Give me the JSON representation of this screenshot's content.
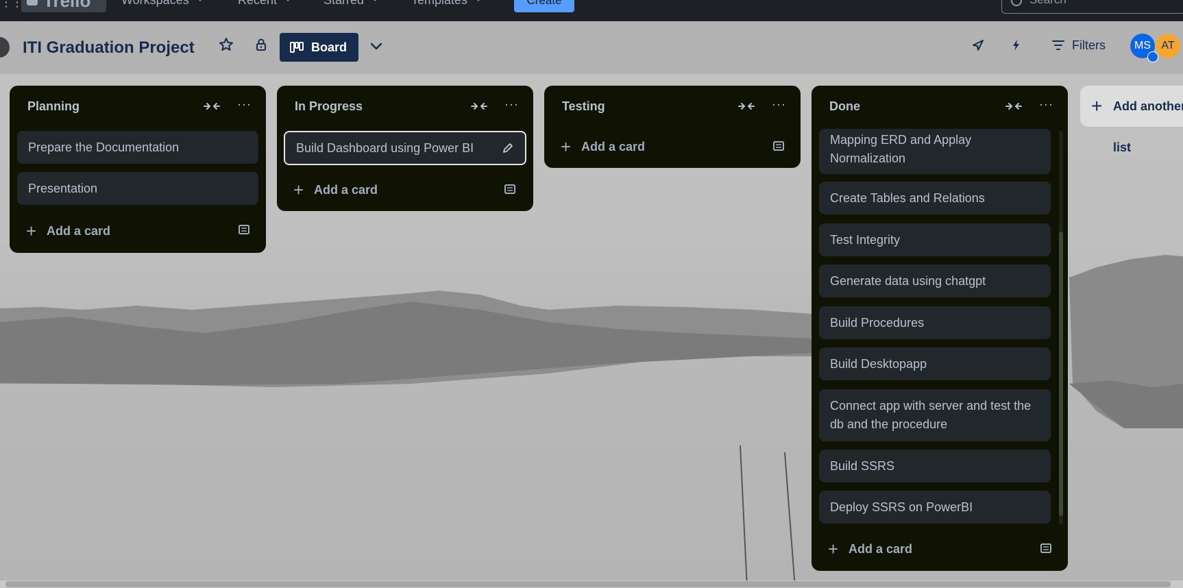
{
  "topnav": {
    "brand": "Trello",
    "items": [
      "Workspaces",
      "Recent",
      "Starred",
      "Templates"
    ],
    "create_label": "Create",
    "search_placeholder": "Search"
  },
  "board": {
    "title": "ITI Graduation Project",
    "view_label": "Board",
    "filters_label": "Filters",
    "members": [
      "MS",
      "AT"
    ]
  },
  "lists": [
    {
      "title": "Planning",
      "cards": [
        "Prepare the Documentation",
        "Presentation"
      ],
      "add_label": "Add a card"
    },
    {
      "title": "In Progress",
      "cards": [
        "Build Dashboard using Power BI"
      ],
      "add_label": "Add a card"
    },
    {
      "title": "Testing",
      "cards": [],
      "add_label": "Add a card"
    },
    {
      "title": "Done",
      "cards": [
        "Mapping ERD and Applay Normalization",
        "Create Tables and Relations",
        "Test Integrity",
        "Generate data using chatgpt",
        "Build Procedures",
        "Build Desktopapp",
        "Connect app with server and test the db and the procedure",
        "Build SSRS",
        "Deploy SSRS on PowerBI"
      ],
      "add_label": "Add a card"
    }
  ],
  "add_list_label": "Add another list",
  "colors": {
    "topnav": "#1d2125",
    "list_bg": "#101204",
    "card_bg": "#22272b",
    "accent": "#579dff"
  }
}
